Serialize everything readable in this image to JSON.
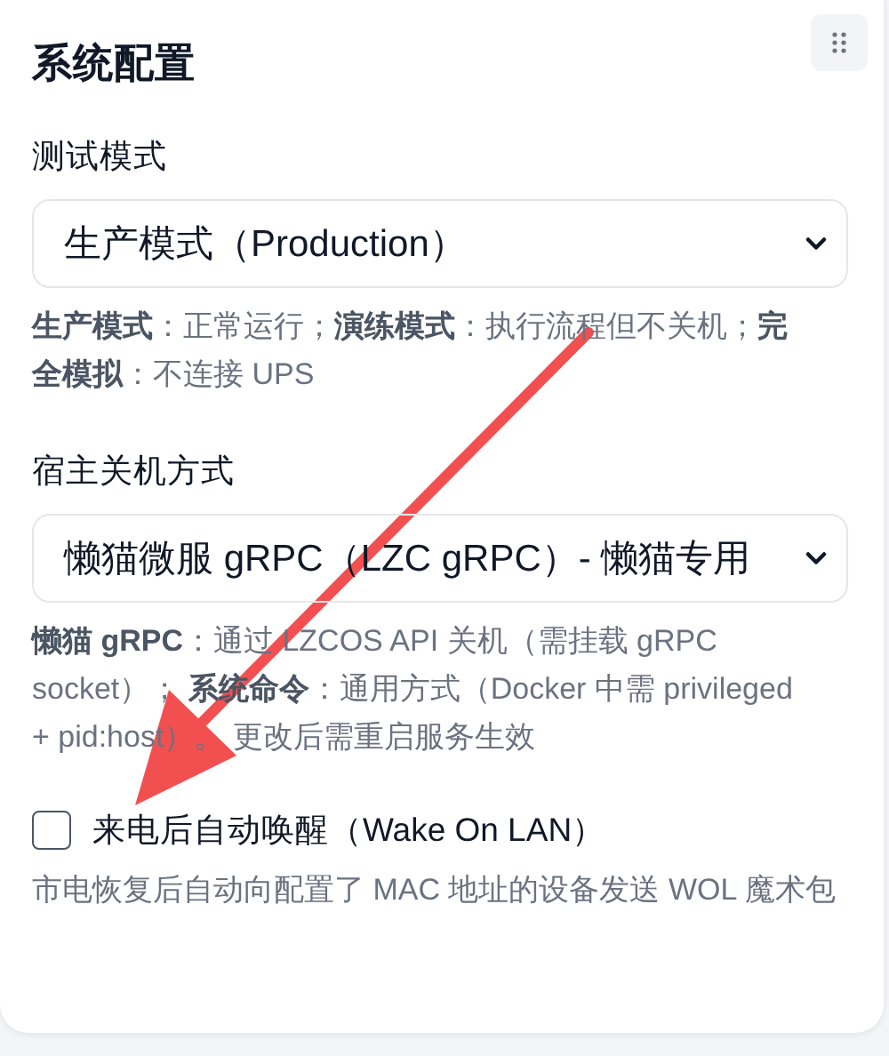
{
  "title": "系统配置",
  "handle": {
    "kind": "drag"
  },
  "fields": [
    {
      "label": "测试模式",
      "value": "生产模式（Production）",
      "hint": "**生产模式**：正常运行；**演练模式**：执行流程但不关机；**完全模拟**：不连接 UPS"
    },
    {
      "label": "宿主关机方式",
      "value": "懒猫微服 gRPC（LZC gRPC）- 懒猫专用",
      "hint": "**懒猫 gRPC**：通过 LZCOS API 关机（需挂载 gRPC socket）； **系统命令**：通用方式（Docker 中需 privileged + pid:host）。 更改后需重启服务生效"
    }
  ],
  "wake": {
    "label": "来电后自动唤醒（Wake On LAN）",
    "checked": false,
    "hint": "市电恢复后自动向配置了 MAC 地址的设备发送 WOL 魔术包"
  },
  "annotations": [
    {
      "kind": "arrow"
    }
  ]
}
